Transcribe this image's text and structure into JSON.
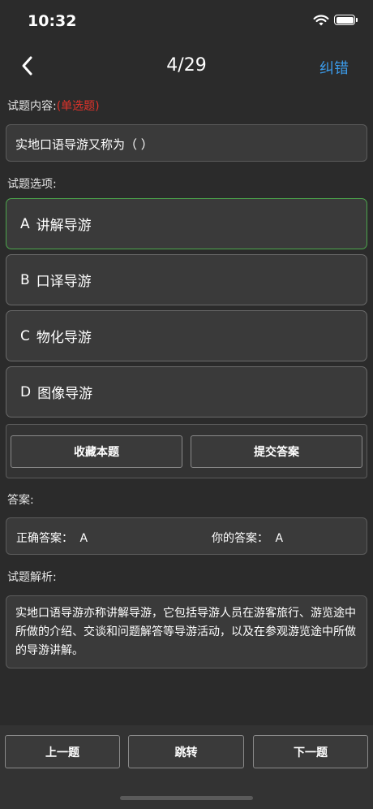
{
  "status_bar": {
    "time": "10:32"
  },
  "nav": {
    "title": "4/29",
    "action_label": "纠错"
  },
  "question": {
    "section_label": "试题内容:",
    "type_label": "(单选题)",
    "text": "实地口语导游又称为（ ）"
  },
  "options": {
    "section_label": "试题选项:",
    "items": [
      {
        "letter": "A",
        "text": "讲解导游",
        "selected": true
      },
      {
        "letter": "B",
        "text": "口译导游",
        "selected": false
      },
      {
        "letter": "C",
        "text": "物化导游",
        "selected": false
      },
      {
        "letter": "D",
        "text": "图像导游",
        "selected": false
      }
    ]
  },
  "actions": {
    "favorite_label": "收藏本题",
    "submit_label": "提交答案"
  },
  "answer": {
    "section_label": "答案:",
    "correct_label": "正确答案：",
    "correct_value": "A",
    "yours_label": "你的答案：",
    "yours_value": "A"
  },
  "analysis": {
    "section_label": "试题解析:",
    "text": "实地口语导游亦称讲解导游，它包括导游人员在游客旅行、游览途中所做的介绍、交谈和问题解答等导游活动，以及在参观游览途中所做的导游讲解。"
  },
  "bottom_nav": {
    "prev_label": "上一题",
    "jump_label": "跳转",
    "next_label": "下一题"
  },
  "colors": {
    "background": "#2b2b2b",
    "accent": "#3b9ae8",
    "question_type": "#e0332b",
    "selected_border": "#4ca64c"
  }
}
